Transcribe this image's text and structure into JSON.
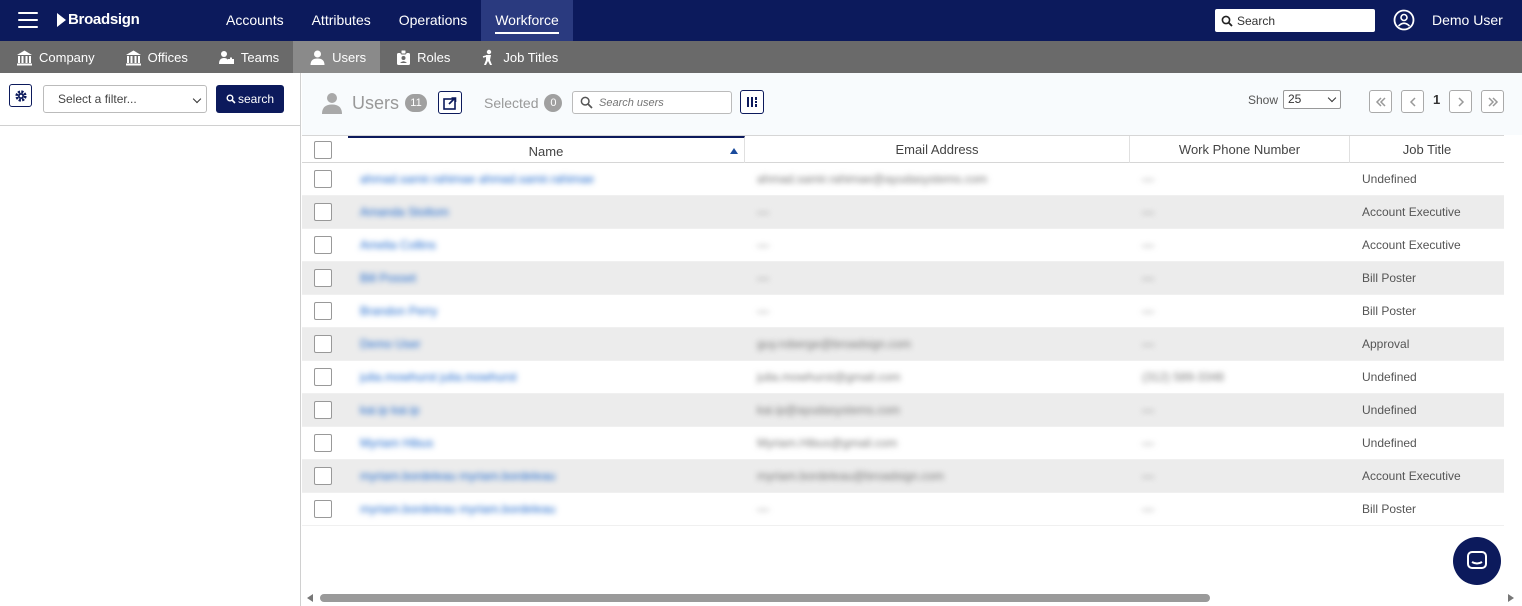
{
  "topbar": {
    "logo": "Broadsign",
    "nav": [
      "Accounts",
      "Attributes",
      "Operations",
      "Workforce"
    ],
    "active_nav": "Workforce",
    "search_placeholder": "Search",
    "user_name": "Demo User",
    "bg_color": "#0c1a5c"
  },
  "subnav": {
    "items": [
      {
        "label": "Company",
        "icon": "building-icon"
      },
      {
        "label": "Offices",
        "icon": "building-icon"
      },
      {
        "label": "Teams",
        "icon": "team-icon"
      },
      {
        "label": "Users",
        "icon": "user-icon"
      },
      {
        "label": "Roles",
        "icon": "role-icon"
      },
      {
        "label": "Job Titles",
        "icon": "job-title-icon"
      }
    ],
    "active": "Users"
  },
  "filters": {
    "select_placeholder": "Select a filter...",
    "search_label": "search"
  },
  "users_toolbar": {
    "title": "Users",
    "count": "11",
    "selected_label": "Selected",
    "selected_count": "0",
    "search_placeholder": "Search users",
    "show_label": "Show",
    "page_size": "25",
    "page": "1"
  },
  "table": {
    "columns": [
      "Name",
      "Email Address",
      "Work Phone Number",
      "Job Title"
    ],
    "sorted_column": "Name",
    "rows": [
      {
        "name": "ahmad.samir.rahimae ahmad.samir.rahimae",
        "email": "ahmad.samir.rahimae@ayudasystems.com",
        "phone": "—",
        "job": "Undefined"
      },
      {
        "name": "Amanda Stoltom",
        "email": "—",
        "phone": "—",
        "job": "Account Executive"
      },
      {
        "name": "Amelia Collins",
        "email": "—",
        "phone": "—",
        "job": "Account Executive"
      },
      {
        "name": "Bill Posset",
        "email": "—",
        "phone": "—",
        "job": "Bill Poster"
      },
      {
        "name": "Brandon Perry",
        "email": "—",
        "phone": "—",
        "job": "Bill Poster"
      },
      {
        "name": "Demo User",
        "email": "guy.roberge@broadsign.com",
        "phone": "—",
        "job": "Approval"
      },
      {
        "name": "julia.mowhurst julia.mowhurst",
        "email": "julia.mowhurst@gmail.com",
        "phone": "(312) 589-3348",
        "job": "Undefined"
      },
      {
        "name": "kai.ip kai.ip",
        "email": "kai.ip@ayudasystems.com",
        "phone": "—",
        "job": "Undefined"
      },
      {
        "name": "Myriam Hibus",
        "email": "Myriam.Hibus@gmail.com",
        "phone": "—",
        "job": "Undefined"
      },
      {
        "name": "myriam.bordeleau myriam.bordeleau",
        "email": "myriam.bordeleau@broadsign.com",
        "phone": "—",
        "job": "Account Executive"
      },
      {
        "name": "myriam.bordeleau myriam.bordeleau",
        "email": "—",
        "phone": "—",
        "job": "Bill Poster"
      }
    ]
  }
}
